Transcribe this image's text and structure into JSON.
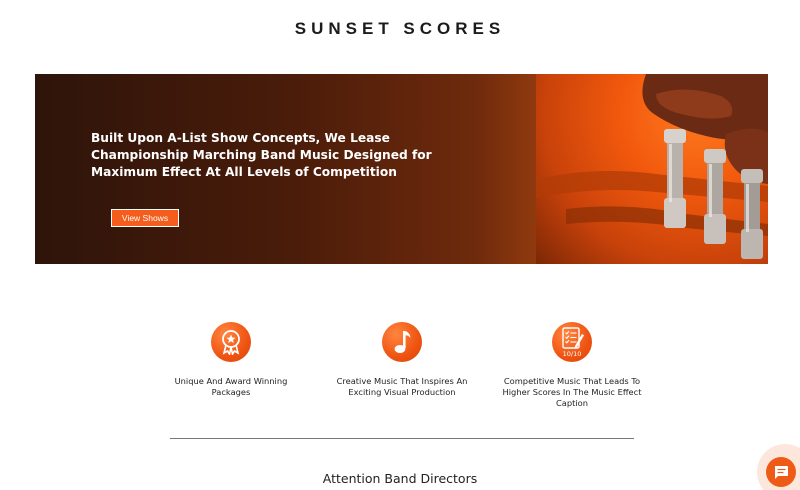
{
  "header": {
    "site_title": "SUNSET SCORES"
  },
  "hero": {
    "headline": "Built Upon A-List Show Concepts, We Lease Championship Marching Band Music Designed for Maximum Effect At All Levels of Competition",
    "button_label": "View Shows"
  },
  "features": [
    {
      "icon": "award-ribbon-icon",
      "text": "Unique And Award Winning Packages"
    },
    {
      "icon": "music-note-icon",
      "text": "Creative Music That Inspires An Exciting Visual Production"
    },
    {
      "icon": "score-sheet-icon",
      "icon_text": "10/10",
      "text": "Competitive Music That Leads To Higher Scores In The Music Effect Caption"
    }
  ],
  "section": {
    "heading": "Attention Band Directors"
  },
  "chat": {
    "icon": "chat-icon"
  },
  "colors": {
    "accent": "#f45d1b",
    "hero_dark": "#2e140a"
  }
}
